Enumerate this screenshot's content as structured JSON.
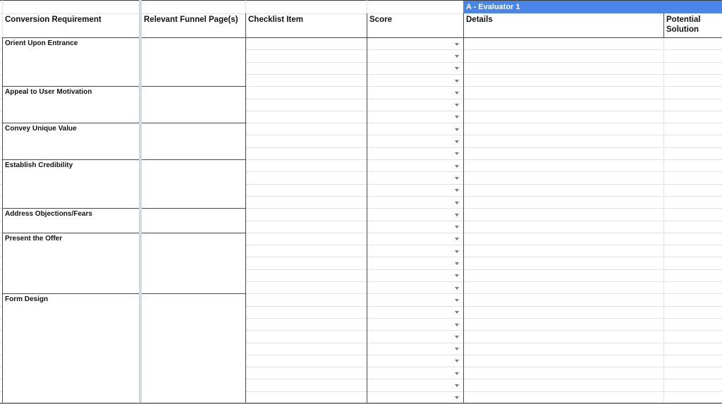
{
  "sheet": {
    "evaluator_band": "A - Evaluator 1",
    "headers": {
      "conversion_requirement": "Conversion Requirement",
      "relevant_funnel_pages": "Relevant Funnel Page(s)",
      "checklist_item": "Checklist Item",
      "score": "Score",
      "details": "Details",
      "potential_solution": "Potential Solution"
    },
    "requirements": [
      {
        "label": "Orient Upon Entrance",
        "rows": 4
      },
      {
        "label": "Appeal to User Motivation",
        "rows": 3
      },
      {
        "label": "Convey Unique Value",
        "rows": 3
      },
      {
        "label": "Establish Credibility",
        "rows": 4
      },
      {
        "label": "Address Objections/Fears",
        "rows": 2
      },
      {
        "label": "Present the Offer",
        "rows": 5
      },
      {
        "label": "Form Design",
        "rows": 9
      }
    ],
    "score_dropdown_icon": "chevron-down-icon",
    "colors": {
      "evaluator_band": "#4a86e8",
      "frozen_divider": "#d4d8de"
    }
  }
}
